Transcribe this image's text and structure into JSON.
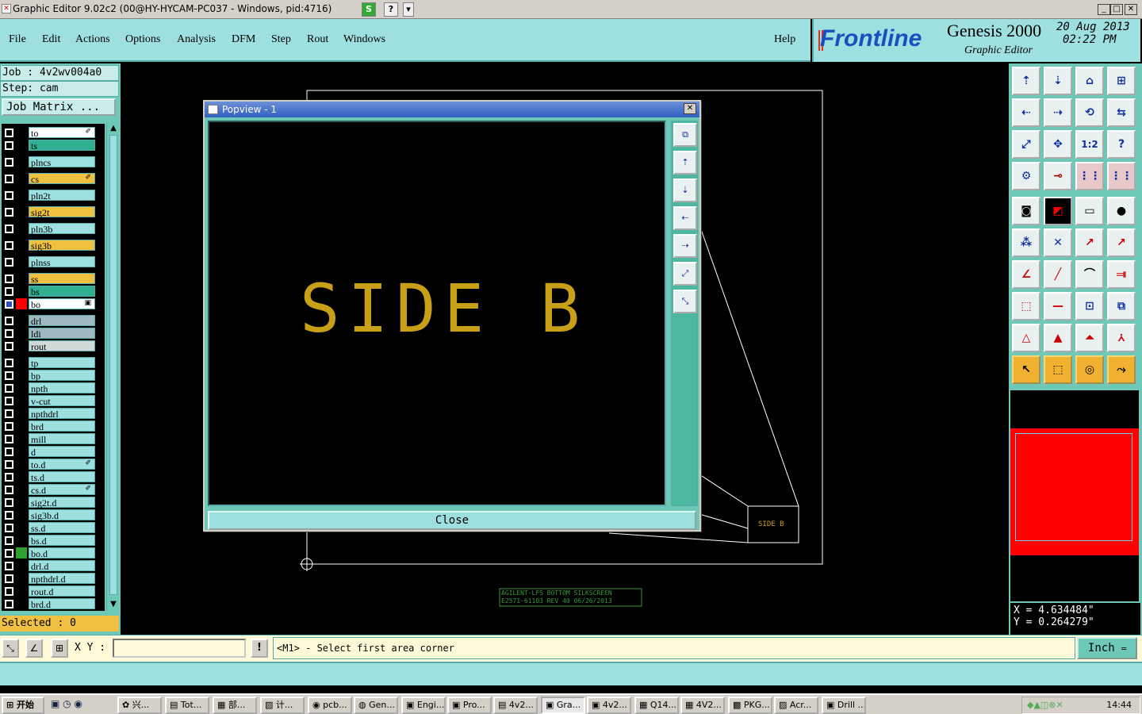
{
  "window": {
    "title": "Graphic Editor 9.02c2 (00@HY-HYCAM-PC037 - Windows, pid:4716)"
  },
  "menu": [
    "File",
    "Edit",
    "Actions",
    "Options",
    "Analysis",
    "DFM",
    "Step",
    "Rout",
    "Windows"
  ],
  "help": "Help",
  "brand": {
    "logo": "Frontline",
    "product": "Genesis 2000",
    "subtitle": "Graphic Editor",
    "date": "20 Aug 2013",
    "time": "02:22 PM"
  },
  "job": {
    "job": "Job : 4v2wv004a0",
    "step": "Step: cam",
    "matrix": "Job Matrix ..."
  },
  "layers": [
    {
      "name": "to",
      "color": "#ffffff",
      "mark": "✐"
    },
    {
      "name": "ts",
      "color": "#30b090",
      "mark": ""
    },
    {
      "name": "plncs",
      "color": "#9ee0e0",
      "mark": ""
    },
    {
      "name": "cs",
      "color": "#f0c040",
      "mark": "✐"
    },
    {
      "name": "pln2t",
      "color": "#9ee0e0",
      "mark": ""
    },
    {
      "name": "sig2t",
      "color": "#f0c040",
      "mark": ""
    },
    {
      "name": "pln3b",
      "color": "#9ee0e0",
      "mark": ""
    },
    {
      "name": "sig3b",
      "color": "#f0c040",
      "mark": ""
    },
    {
      "name": "plnss",
      "color": "#9ee0e0",
      "mark": ""
    },
    {
      "name": "ss",
      "color": "#f0c040",
      "mark": ""
    },
    {
      "name": "bs",
      "color": "#30b090",
      "mark": ""
    },
    {
      "name": "bo",
      "color": "#ffffff",
      "mark": "▣"
    },
    {
      "name": "drl",
      "color": "#a0b8c0",
      "mark": ""
    },
    {
      "name": "ldi",
      "color": "#a0b8c0",
      "mark": ""
    },
    {
      "name": "rout",
      "color": "#d0d8d8",
      "mark": ""
    },
    {
      "name": "tp",
      "color": "#9ee0e0",
      "mark": ""
    },
    {
      "name": "bp",
      "color": "#9ee0e0",
      "mark": ""
    },
    {
      "name": "npth",
      "color": "#9ee0e0",
      "mark": ""
    },
    {
      "name": "v-cut",
      "color": "#9ee0e0",
      "mark": ""
    },
    {
      "name": "npthdrl",
      "color": "#9ee0e0",
      "mark": ""
    },
    {
      "name": "brd",
      "color": "#9ee0e0",
      "mark": ""
    },
    {
      "name": "mill",
      "color": "#9ee0e0",
      "mark": ""
    },
    {
      "name": "d",
      "color": "#9ee0e0",
      "mark": ""
    },
    {
      "name": "to.d",
      "color": "#9ee0e0",
      "mark": "✐"
    },
    {
      "name": "ts.d",
      "color": "#9ee0e0",
      "mark": ""
    },
    {
      "name": "cs.d",
      "color": "#9ee0e0",
      "mark": "✐"
    },
    {
      "name": "sig2t.d",
      "color": "#9ee0e0",
      "mark": ""
    },
    {
      "name": "sig3b.d",
      "color": "#9ee0e0",
      "mark": ""
    },
    {
      "name": "ss.d",
      "color": "#9ee0e0",
      "mark": ""
    },
    {
      "name": "bs.d",
      "color": "#9ee0e0",
      "mark": ""
    },
    {
      "name": "bo.d",
      "color": "#9ee0e0",
      "mark": ""
    },
    {
      "name": "drl.d",
      "color": "#9ee0e0",
      "mark": ""
    },
    {
      "name": "npthdrl.d",
      "color": "#9ee0e0",
      "mark": ""
    },
    {
      "name": "rout.d",
      "color": "#9ee0e0",
      "mark": ""
    },
    {
      "name": "brd.d",
      "color": "#9ee0e0",
      "mark": ""
    }
  ],
  "selected": "Selected : 0",
  "popup": {
    "title": "Popview - 1",
    "content": "SIDE B",
    "close": "Close"
  },
  "canvas": {
    "side_label": "SIDE B",
    "silk_line1": "AGILENT-LFS BOTTOM SILKSCREEN",
    "silk_line2": "E2571-61103 REV 40 06/26/2013"
  },
  "coords": {
    "x": "X = 4.634484\"",
    "y": "Y = 0.264279\""
  },
  "cmd": {
    "xy_label": "X Y :",
    "prompt": "<M1> - Select first area corner",
    "unit": "Inch"
  },
  "taskbar": {
    "start": "开始",
    "clock": "14:44",
    "tasks": [
      "兴...",
      "Tot...",
      "部...",
      "计...",
      "pcb...",
      "Gen...",
      "Engi...",
      "Pro...",
      "4v2...",
      "Gra...",
      "4v2...",
      "Q14...",
      "4V2...",
      "PKG...",
      "Acr...",
      "Drill ..."
    ]
  }
}
